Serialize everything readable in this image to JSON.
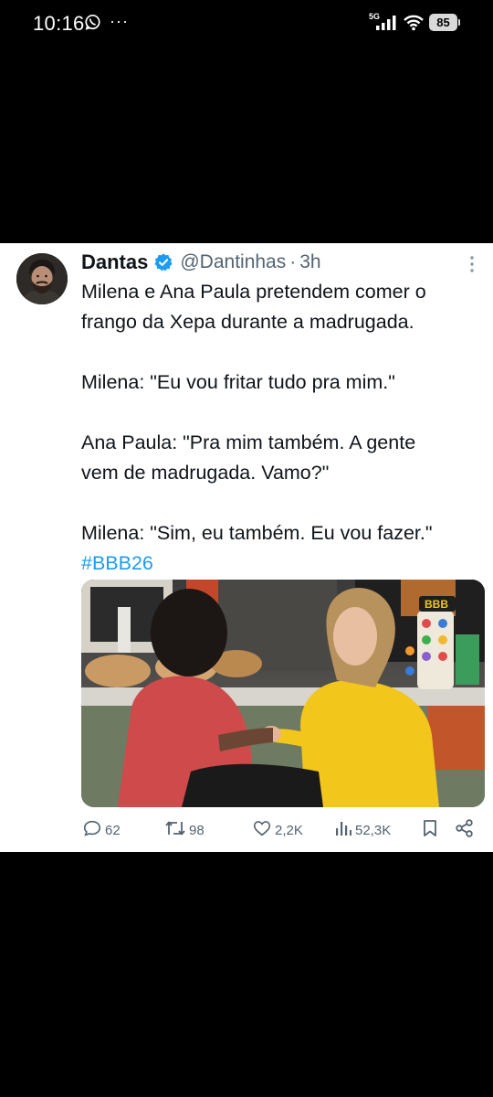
{
  "status_bar": {
    "time": "10:16",
    "notification_more": "···",
    "network": "5G",
    "battery": "85",
    "icons": [
      "whatsapp-icon",
      "signal-icon",
      "wifi-icon",
      "battery-icon"
    ]
  },
  "tweet": {
    "author": {
      "display_name": "Dantas",
      "handle": "@Dantinhas",
      "separator": "·",
      "time_ago": "3h",
      "verified": true
    },
    "lines": [
      "Milena e Ana Paula pretendem comer o",
      "frango da Xepa durante a madrugada.",
      "",
      "Milena: \"Eu vou fritar tudo pra mim.\"",
      "",
      "Ana Paula: \"Pra mim também. A gente",
      "vem de madrugada. Vamo?\"",
      "",
      "Milena: \"Sim, eu também. Eu vou fazer.\""
    ],
    "hashtag": "#BBB26",
    "media_logo": "BBB",
    "actions": {
      "replies": "62",
      "retweets": "98",
      "likes": "2,2K",
      "views": "52,3K"
    }
  },
  "colors": {
    "link": "#1d9bf0",
    "secondary_text": "#536471",
    "verified": "#1d9bf0",
    "background": "#000000",
    "card": "#ffffff"
  }
}
